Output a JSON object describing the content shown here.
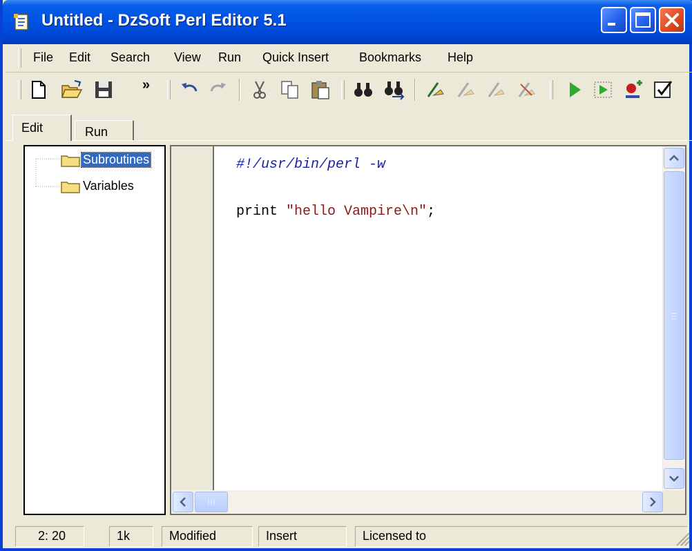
{
  "window": {
    "title": "Untitled - DzSoft Perl Editor 5.1"
  },
  "menu": [
    "File",
    "Edit",
    "Search",
    "View",
    "Run",
    "Quick Insert",
    "Bookmarks",
    "Help"
  ],
  "toolbar": {
    "overflow_chevron": "»"
  },
  "tabs": [
    {
      "label": "Edit",
      "active": true
    },
    {
      "label": "Run",
      "active": false
    }
  ],
  "tree": {
    "items": [
      {
        "label": "Subroutines",
        "selected": true
      },
      {
        "label": "Variables",
        "selected": false
      }
    ]
  },
  "editor": {
    "line1": "#!/usr/bin/perl -w",
    "line3_prefix": "print ",
    "line3_string": "\"hello Vampire\\n\"",
    "line3_suffix": ";"
  },
  "status": {
    "position": "2: 20",
    "size": "1k",
    "modified": "Modified",
    "mode": "Insert",
    "license": "Licensed to"
  },
  "colors": {
    "titlebar": "#0055e5",
    "selection": "#316ac5",
    "comment": "#1b1fa8",
    "string": "#8b1a1a",
    "run_green": "#2eab2e"
  }
}
